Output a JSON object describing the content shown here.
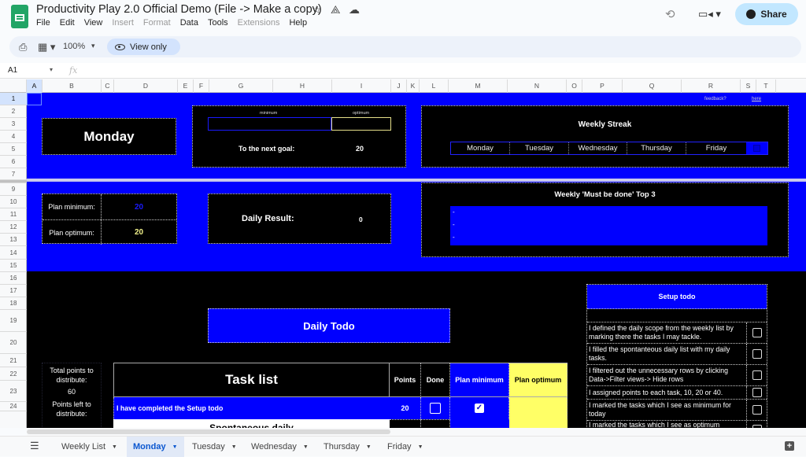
{
  "app": {
    "title": "Productivity Play 2.0 Official Demo (File -> Make a copy)",
    "menu": [
      {
        "label": "File",
        "enabled": true
      },
      {
        "label": "Edit",
        "enabled": true
      },
      {
        "label": "View",
        "enabled": true
      },
      {
        "label": "Insert",
        "enabled": false
      },
      {
        "label": "Format",
        "enabled": false
      },
      {
        "label": "Data",
        "enabled": true
      },
      {
        "label": "Tools",
        "enabled": true
      },
      {
        "label": "Extensions",
        "enabled": false
      },
      {
        "label": "Help",
        "enabled": true
      }
    ],
    "share_label": "Share",
    "icons": {
      "star": "☆",
      "drive": "⟁",
      "cloud": "☁",
      "history": "⟲",
      "meet": "▭◂ ▾"
    }
  },
  "toolbar": {
    "print_icon": "⎙",
    "format_icon": "▦ ▾",
    "zoom": "100%",
    "zoom_caret": "▾",
    "view_only": "View only"
  },
  "formula_bar": {
    "cell_ref": "A1",
    "caret": "▾",
    "fx": "fx",
    "value": ""
  },
  "grid": {
    "columns": [
      "A",
      "B",
      "C",
      "D",
      "E",
      "F",
      "G",
      "H",
      "I",
      "J",
      "K",
      "L",
      "M",
      "N",
      "O",
      "P",
      "Q",
      "R",
      "S",
      "T"
    ],
    "rows": [
      "1",
      "2",
      "3",
      "4",
      "5",
      "6",
      "7",
      "9",
      "10",
      "11",
      "12",
      "13",
      "14",
      "15",
      "16",
      "17",
      "18",
      "19",
      "20",
      "21",
      "22",
      "23",
      "24"
    ],
    "selected_cell": "A1"
  },
  "sheet": {
    "feedback_label": "feedback?",
    "feedback_link": "here",
    "day_name": "Monday",
    "goal": {
      "min_label": "minimum",
      "opt_label": "optimum",
      "next_goal_label": "To the next goal:",
      "next_goal_value": "20"
    },
    "weekly_streak": {
      "title": "Weekly Streak",
      "days": [
        "Monday",
        "Tuesday",
        "Wednesday",
        "Thursday",
        "Friday"
      ]
    },
    "plan": {
      "min_label": "Plan minimum:",
      "min_value": "20",
      "opt_label": "Plan optimum:",
      "opt_value": "20"
    },
    "daily_result": {
      "label": "Daily Result:",
      "value": "0"
    },
    "top3": {
      "title": "Weekly 'Must be done' Top 3",
      "items": [
        "-",
        "-",
        "-"
      ]
    },
    "daily_todo": "Daily Todo",
    "setup_todo": {
      "title": "Setup todo",
      "items": [
        {
          "text": "I defined the daily scope from the weekly list by marking there the tasks I may tackle.",
          "checked": false
        },
        {
          "text": "I filled the spontanteous daily list with my daily tasks.",
          "checked": false
        },
        {
          "text": "I filtered out the unnecessary rows by clicking Data->Filter views-> Hide rows",
          "checked": false
        },
        {
          "text": "I assigned points to each task, 10, 20 or 40.",
          "checked": false
        },
        {
          "text": "I marked the tasks which I see as minimum for today",
          "checked": false
        },
        {
          "text": "I marked the tasks which I see as optimum",
          "checked": false
        }
      ]
    },
    "points": {
      "total_label": "Total points to distribute:",
      "total_value": "60",
      "left_label": "Points left to distribute:"
    },
    "task_list": {
      "title": "Task list",
      "headers": {
        "points": "Points",
        "done": "Done",
        "plan_min": "Plan minimum",
        "plan_opt": "Plan optimum"
      },
      "rows": [
        {
          "task": "I have completed the Setup todo",
          "points": "20",
          "done": false,
          "plan_min": true,
          "plan_opt": false
        },
        {
          "task": "Spontaneous daily",
          "points": "",
          "done": false,
          "plan_min": false,
          "plan_opt": false
        }
      ]
    }
  },
  "tabs": [
    {
      "label": "Weekly List",
      "active": false
    },
    {
      "label": "Monday",
      "active": true
    },
    {
      "label": "Tuesday",
      "active": false
    },
    {
      "label": "Wednesday",
      "active": false
    },
    {
      "label": "Thursday",
      "active": false
    },
    {
      "label": "Friday",
      "active": false
    }
  ],
  "colors": {
    "sheet_blue": "#0000ff",
    "sheet_black": "#000000",
    "plan_optimum_yellow": "#ffff66",
    "plan_min_value": "#1a1aff",
    "plan_opt_value": "#f0f08a",
    "share_bg": "#c2e7ff",
    "active_tab": "#0b57d0"
  }
}
